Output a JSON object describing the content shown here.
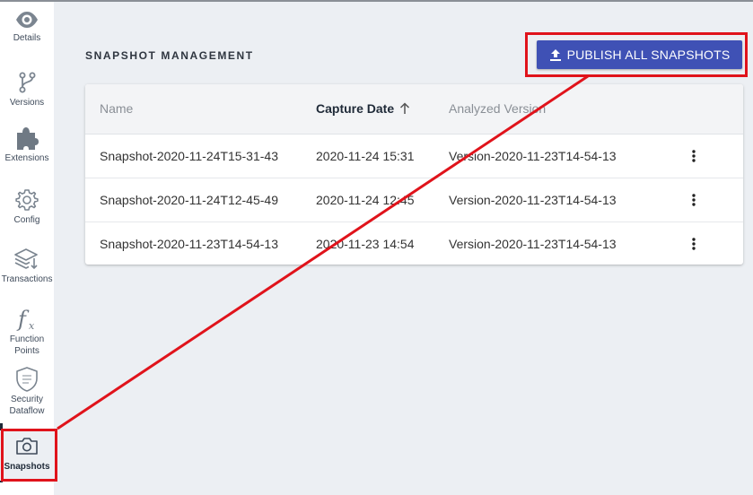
{
  "sidebar": {
    "items": [
      {
        "label": "Details",
        "icon": "eye-icon"
      },
      {
        "label": "Versions",
        "icon": "git-branch-icon"
      },
      {
        "label": "Extensions",
        "icon": "puzzle-icon"
      },
      {
        "label": "Config",
        "icon": "gear-icon"
      },
      {
        "label": "Transactions",
        "icon": "layers-icon"
      },
      {
        "label": "Function\nPoints",
        "icon": "function-icon"
      },
      {
        "label": "Security\nDataflow",
        "icon": "shield-icon"
      },
      {
        "label": "Snapshots",
        "icon": "camera-icon",
        "active": true
      }
    ]
  },
  "main": {
    "title": "SNAPSHOT MANAGEMENT",
    "publish_label": "PUBLISH ALL SNAPSHOTS",
    "table": {
      "columns": [
        "Name",
        "Capture Date",
        "Analyzed Version"
      ],
      "sorted_column": "Capture Date",
      "rows": [
        {
          "name": "Snapshot-2020-11-24T15-31-43",
          "date": "2020-11-24 15:31",
          "version": "Version-2020-11-23T14-54-13"
        },
        {
          "name": "Snapshot-2020-11-24T12-45-49",
          "date": "2020-11-24 12:45",
          "version": "Version-2020-11-23T14-54-13"
        },
        {
          "name": "Snapshot-2020-11-23T14-54-13",
          "date": "2020-11-23 14:54",
          "version": "Version-2020-11-23T14-54-13"
        }
      ]
    }
  },
  "colors": {
    "accent": "#3f51b5",
    "annotation": "#e0131b",
    "sidebar_text": "#3e4a5a"
  }
}
